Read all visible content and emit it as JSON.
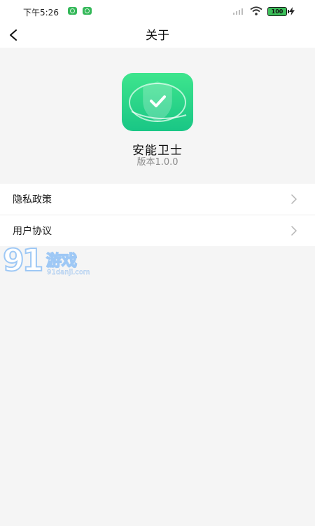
{
  "status_bar": {
    "time": "下午5:26",
    "battery": "100"
  },
  "nav": {
    "title": "关于"
  },
  "app": {
    "name": "安能卫士",
    "version": "版本1.0.0"
  },
  "menu": {
    "items": [
      {
        "label": "隐私政策"
      },
      {
        "label": "用户协议"
      }
    ]
  },
  "watermark": {
    "number": "91",
    "text": "游戏",
    "url": "91danji.com"
  },
  "colors": {
    "app_icon": "#1fcf87",
    "background": "#f5f5f5",
    "battery": "#3cc05a"
  }
}
